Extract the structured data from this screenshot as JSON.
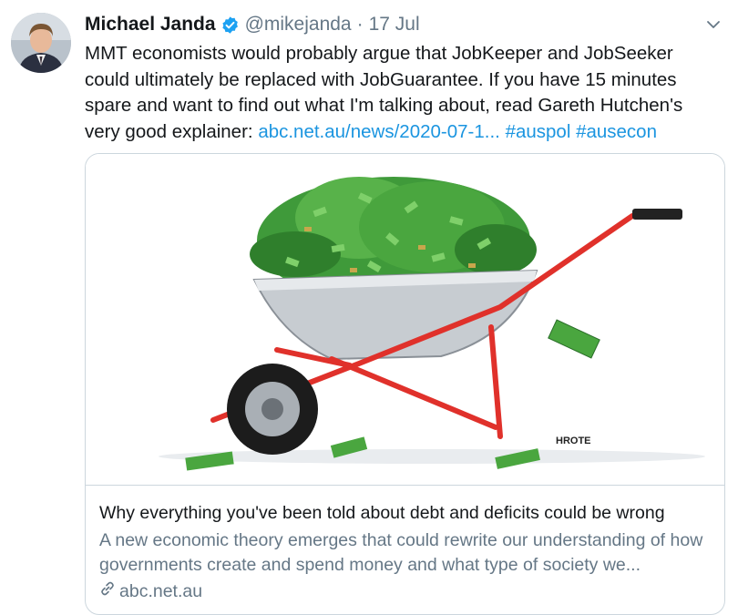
{
  "tweet": {
    "author_name": "Michael Janda",
    "handle": "@mikejanda",
    "separator": "·",
    "date": "17 Jul",
    "text_parts": [
      "MMT economists would probably argue that JobKeeper and JobSeeker could ultimately be replaced with JobGuarantee. If you have 15 minutes spare and want to find out what I'm talking about, read Gareth Hutchen's very good explainer: "
    ],
    "link": "abc.net.au/news/2020-07-1...",
    "hashtags": [
      "#auspol",
      "#ausecon"
    ]
  },
  "card": {
    "image_signature": "HROTE",
    "title": "Why everything you've been told about debt and deficits could be wrong",
    "description": "A new economic theory emerges that could rewrite our understanding of how governments create and spend money and what type of society we...",
    "domain": "abc.net.au"
  },
  "colors": {
    "link": "#1b95e0",
    "secondary_text": "#657786",
    "border": "#ccd6dd",
    "verified": "#1da1f2"
  },
  "icons": {
    "verified": "verified-badge-icon",
    "caret": "chevron-down-icon",
    "link": "link-icon"
  }
}
